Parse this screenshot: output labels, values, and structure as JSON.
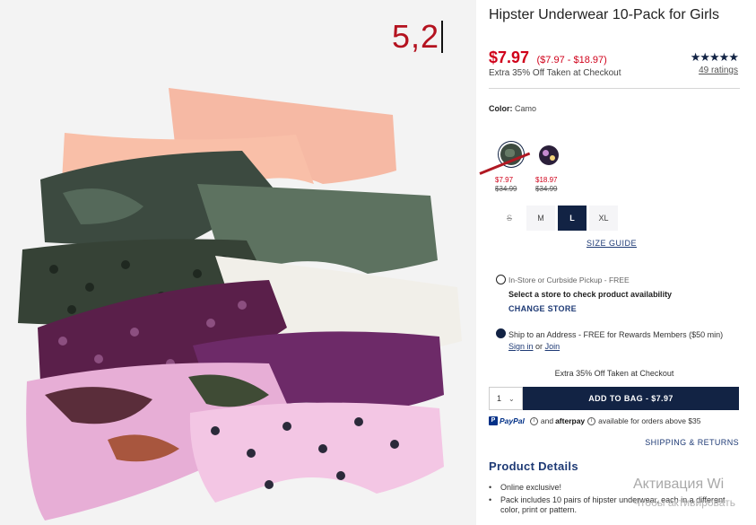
{
  "annotation": "5,2",
  "product": {
    "title": "Hipster Underwear 10-Pack for Girls",
    "price": "$7.97",
    "price_range": "($7.97 - $18.97)",
    "promo": "Extra 35% Off Taken at Checkout",
    "rating_stars": "★★★★★",
    "ratings_count": "49 ratings"
  },
  "color": {
    "label": "Color:",
    "value": "Camo",
    "swatches": [
      {
        "name": "Camo",
        "sale": "$7.97",
        "original": "$34.99"
      },
      {
        "name": "Floral",
        "sale": "$18.97",
        "original": "$34.99"
      }
    ]
  },
  "sizes": {
    "options": [
      "S",
      "M",
      "L",
      "XL"
    ],
    "selected": "L",
    "unavailable": "S",
    "guide_link": "SIZE GUIDE"
  },
  "fulfillment": {
    "pickup_label": "In-Store or Curbside Pickup - FREE",
    "select_store": "Select a store to check product availability",
    "change_store": "CHANGE STORE",
    "ship_text": "Ship to an Address - FREE for Rewards Members ($50 min)",
    "sign_in": "Sign in",
    "or": "or",
    "join": "Join",
    "selected": "ship"
  },
  "cart": {
    "promo": "Extra 35% Off Taken at Checkout",
    "quantity": "1",
    "add_to_bag": "ADD TO BAG - $7.97"
  },
  "payments": {
    "paypal": "PayPal",
    "and": "and",
    "afterpay": "afterpay",
    "suffix": "available for orders above $35",
    "shipping_returns": "SHIPPING & RETURNS"
  },
  "details": {
    "title": "Product Details",
    "items": [
      "Online exclusive!",
      "Pack includes 10 pairs of hipster underwear, each in a different color, print or pattern."
    ]
  },
  "os_watermark": {
    "line1": "Активация Wi",
    "line2": "Чтобы активировать"
  },
  "colors": {
    "accent_navy": "#122344",
    "sale_red": "#d0021b",
    "link_blue": "#1e3a75"
  }
}
